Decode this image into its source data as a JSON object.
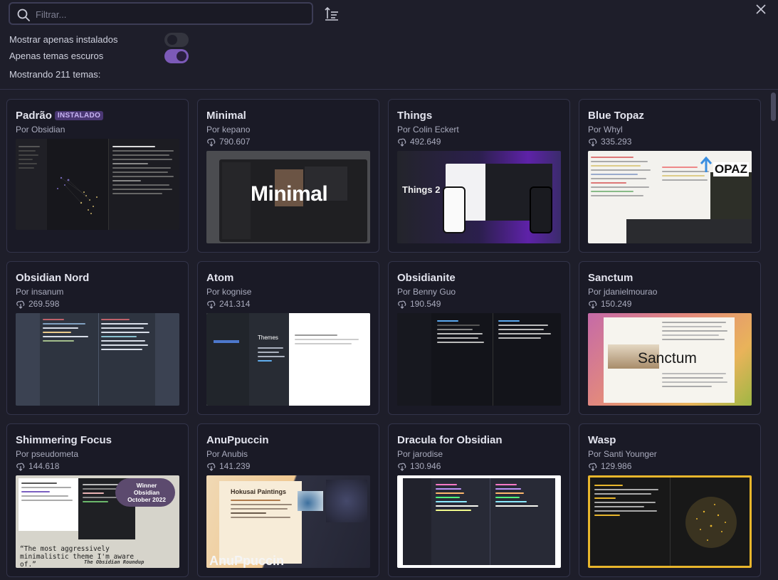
{
  "header": {
    "search_placeholder": "Filtrar...",
    "toggles": [
      {
        "label": "Mostrar apenas instalados",
        "on": false
      },
      {
        "label": "Apenas temas escuros",
        "on": true
      }
    ],
    "count_text": "Mostrando 211 temas:"
  },
  "cards": [
    {
      "title": "Padrão",
      "badge": "INSTALADO",
      "author": "Por Obsidian",
      "downloads": "",
      "preview_text": ""
    },
    {
      "title": "Minimal",
      "badge": "",
      "author": "Por kepano",
      "downloads": "790.607",
      "preview_text": "Minimal"
    },
    {
      "title": "Things",
      "badge": "",
      "author": "Por Colin Eckert",
      "downloads": "492.649",
      "preview_text": "Things 2"
    },
    {
      "title": "Blue Topaz",
      "badge": "",
      "author": "Por Whyl",
      "downloads": "335.293",
      "preview_text": "OPAZ"
    },
    {
      "title": "Obsidian Nord",
      "badge": "",
      "author": "Por insanum",
      "downloads": "269.598",
      "preview_text": ""
    },
    {
      "title": "Atom",
      "badge": "",
      "author": "Por kognise",
      "downloads": "241.314",
      "preview_text": "Themes"
    },
    {
      "title": "Obsidianite",
      "badge": "",
      "author": "Por Benny Guo",
      "downloads": "190.549",
      "preview_text": ""
    },
    {
      "title": "Sanctum",
      "badge": "",
      "author": "Por jdanielmourao",
      "downloads": "150.249",
      "preview_text": "Sanctum"
    },
    {
      "title": "Shimmering Focus",
      "badge": "",
      "author": "Por pseudometa",
      "downloads": "144.618",
      "preview_text": "“The most aggressively minimalistic theme I'm aware of.”",
      "preview_sub": "The Obsidian Roundup",
      "preview_award": "Winner Obsidian October 2022"
    },
    {
      "title": "AnuPpuccin",
      "badge": "",
      "author": "Por Anubis",
      "downloads": "141.239",
      "preview_text": "AnuPpuccin",
      "preview_sub": "Hokusai Paintings"
    },
    {
      "title": "Dracula for Obsidian",
      "badge": "",
      "author": "Por jarodise",
      "downloads": "130.946",
      "preview_text": ""
    },
    {
      "title": "Wasp",
      "badge": "",
      "author": "Por Santi Younger",
      "downloads": "129.986",
      "preview_text": ""
    }
  ]
}
